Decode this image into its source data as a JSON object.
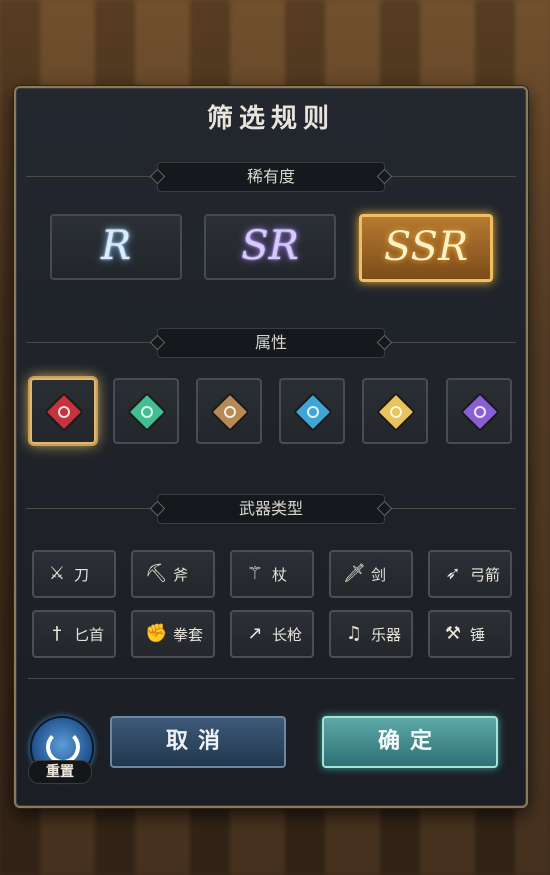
{
  "dialog": {
    "title": "筛选规则"
  },
  "sections": {
    "rarity": "稀有度",
    "attribute": "属性",
    "weapon_type": "武器类型"
  },
  "rarity_options": [
    {
      "label": "R",
      "selected": false,
      "color": "#d9ecff"
    },
    {
      "label": "SR",
      "selected": false,
      "color": "#d8c8ff"
    },
    {
      "label": "SSR",
      "selected": true,
      "color": "#fff1c8"
    }
  ],
  "attributes": [
    {
      "icon": "fire-gem-icon",
      "color": "#c8323c",
      "selected": true
    },
    {
      "icon": "wind-gem-icon",
      "color": "#3fbf92",
      "selected": false
    },
    {
      "icon": "earth-gem-icon",
      "color": "#b78a55",
      "selected": false
    },
    {
      "icon": "water-gem-icon",
      "color": "#3ea6d6",
      "selected": false
    },
    {
      "icon": "light-gem-icon",
      "color": "#e8c35a",
      "selected": false
    },
    {
      "icon": "dark-gem-icon",
      "color": "#8a5ed6",
      "selected": false
    }
  ],
  "weapons": [
    {
      "label": "刀",
      "icon": "crossed-blades-icon"
    },
    {
      "label": "斧",
      "icon": "axe-icon"
    },
    {
      "label": "杖",
      "icon": "staff-icon"
    },
    {
      "label": "剑",
      "icon": "sword-icon"
    },
    {
      "label": "弓箭",
      "icon": "bow-icon"
    },
    {
      "label": "匕首",
      "icon": "dagger-icon"
    },
    {
      "label": "拳套",
      "icon": "gauntlet-icon"
    },
    {
      "label": "长枪",
      "icon": "spear-icon"
    },
    {
      "label": "乐器",
      "icon": "harp-icon"
    },
    {
      "label": "锤",
      "icon": "hammer-icon"
    }
  ],
  "footer": {
    "reset_label": "重置",
    "cancel_label": "取消",
    "confirm_label": "确定"
  }
}
